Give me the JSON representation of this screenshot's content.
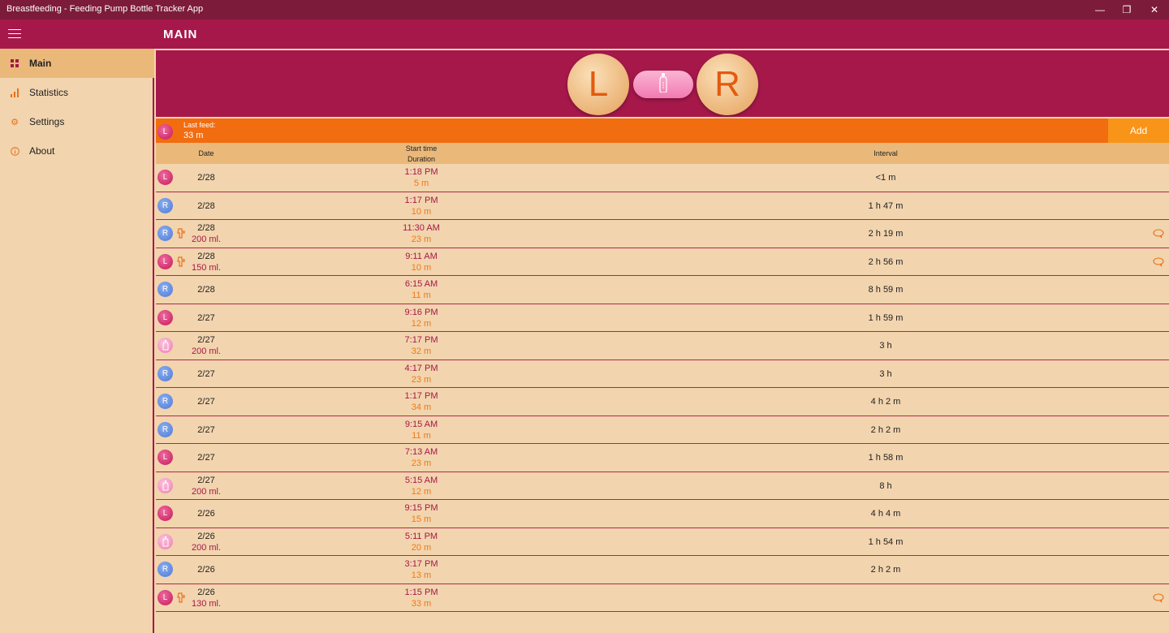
{
  "window": {
    "title": "Breastfeeding - Feeding Pump Bottle Tracker App"
  },
  "header": {
    "title": "MAIN"
  },
  "sidebar": {
    "items": [
      {
        "label": "Main",
        "icon": "grid-icon"
      },
      {
        "label": "Statistics",
        "icon": "bar-chart-icon"
      },
      {
        "label": "Settings",
        "icon": "gear-icon"
      },
      {
        "label": "About",
        "icon": "info-icon"
      }
    ]
  },
  "controls": {
    "left_label": "L",
    "right_label": "R"
  },
  "last_feed": {
    "label": "Last feed:",
    "value": "33 m",
    "side": "L",
    "add_label": "Add"
  },
  "table": {
    "headers": {
      "date": "Date",
      "start_time": "Start time",
      "duration": "Duration",
      "interval": "Interval"
    },
    "rows": [
      {
        "type": "L",
        "date": "2/28",
        "time": "1:18 PM",
        "duration": "5 m",
        "interval": "<1 m"
      },
      {
        "type": "R",
        "date": "2/28",
        "time": "1:17 PM",
        "duration": "10 m",
        "interval": "1 h 47 m"
      },
      {
        "type": "R",
        "pump": true,
        "date": "2/28",
        "amount": "200 ml.",
        "time": "11:30 AM",
        "duration": "23 m",
        "interval": "2 h 19 m",
        "note": true
      },
      {
        "type": "L",
        "pump": true,
        "date": "2/28",
        "amount": "150 ml.",
        "time": "9:11 AM",
        "duration": "10 m",
        "interval": "2 h 56 m",
        "note": true
      },
      {
        "type": "R",
        "date": "2/28",
        "time": "6:15 AM",
        "duration": "11 m",
        "interval": "8 h 59 m"
      },
      {
        "type": "L",
        "date": "2/27",
        "time": "9:16 PM",
        "duration": "12 m",
        "interval": "1 h 59 m"
      },
      {
        "type": "B",
        "date": "2/27",
        "amount": "200 ml.",
        "time": "7:17 PM",
        "duration": "32 m",
        "interval": "3 h"
      },
      {
        "type": "R",
        "date": "2/27",
        "time": "4:17 PM",
        "duration": "23 m",
        "interval": "3 h"
      },
      {
        "type": "R",
        "date": "2/27",
        "time": "1:17 PM",
        "duration": "34 m",
        "interval": "4 h 2 m"
      },
      {
        "type": "R",
        "date": "2/27",
        "time": "9:15 AM",
        "duration": "11 m",
        "interval": "2 h 2 m"
      },
      {
        "type": "L",
        "date": "2/27",
        "time": "7:13 AM",
        "duration": "23 m",
        "interval": "1 h 58 m"
      },
      {
        "type": "B",
        "date": "2/27",
        "amount": "200 ml.",
        "time": "5:15 AM",
        "duration": "12 m",
        "interval": "8 h"
      },
      {
        "type": "L",
        "date": "2/26",
        "time": "9:15 PM",
        "duration": "15 m",
        "interval": "4 h 4 m"
      },
      {
        "type": "B",
        "date": "2/26",
        "amount": "200 ml.",
        "time": "5:11 PM",
        "duration": "20 m",
        "interval": "1 h 54 m"
      },
      {
        "type": "R",
        "date": "2/26",
        "time": "3:17 PM",
        "duration": "13 m",
        "interval": "2 h 2 m"
      },
      {
        "type": "L",
        "pump": true,
        "date": "2/26",
        "amount": "130 ml.",
        "time": "1:15 PM",
        "duration": "33 m",
        "interval": "",
        "note": true
      }
    ]
  },
  "colors": {
    "primary": "#a6184a",
    "accent": "#f26c10",
    "background": "#f2d4ae",
    "left": "#c41857",
    "right": "#4d7ad6"
  }
}
